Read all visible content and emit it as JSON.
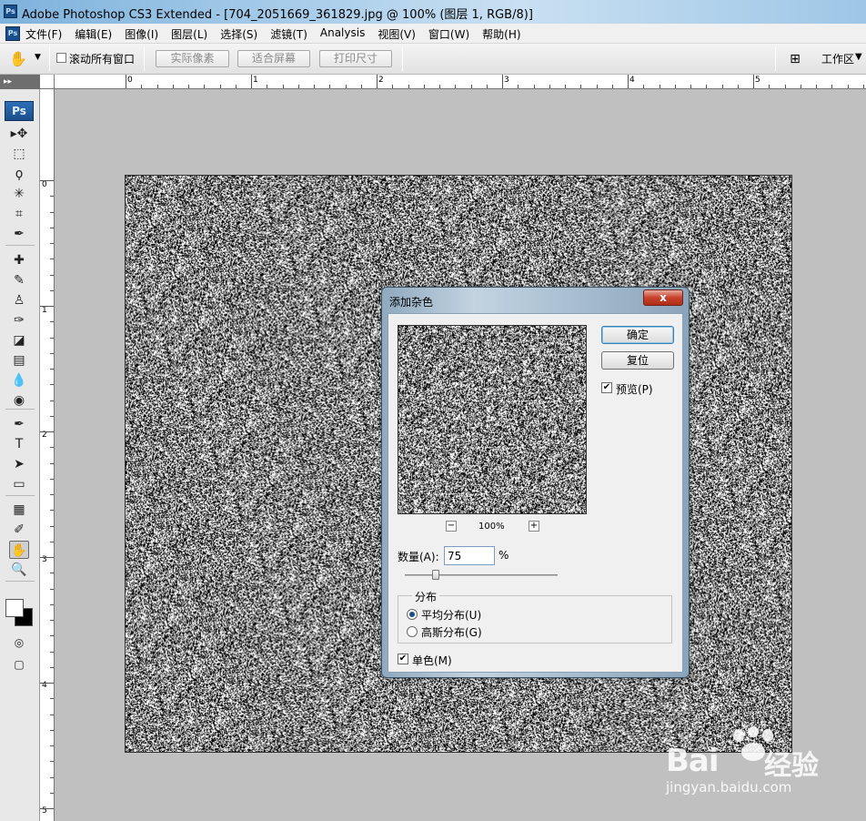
{
  "window": {
    "title": "Adobe Photoshop CS3 Extended - [704_2051669_361829.jpg @ 100% (图层 1, RGB/8)]",
    "app_badge": "Ps"
  },
  "menu": [
    {
      "label": "文件(F)"
    },
    {
      "label": "编辑(E)"
    },
    {
      "label": "图像(I)"
    },
    {
      "label": "图层(L)"
    },
    {
      "label": "选择(S)"
    },
    {
      "label": "滤镜(T)"
    },
    {
      "label": "Analysis"
    },
    {
      "label": "视图(V)"
    },
    {
      "label": "窗口(W)"
    },
    {
      "label": "帮助(H)"
    }
  ],
  "options_bar": {
    "scroll_all_label": "滚动所有窗口",
    "scroll_all_checked": false,
    "actual_pixels": "实际像素",
    "fit_screen": "适合屏幕",
    "print_size": "打印尺寸",
    "workspace": "工作区"
  },
  "toolbox": {
    "grip": "▸▸",
    "badge": "Ps",
    "tools": [
      {
        "name": "move-tool",
        "glyph": "▸✥"
      },
      {
        "name": "marquee-tool",
        "glyph": "⬚"
      },
      {
        "name": "lasso-tool",
        "glyph": "ϙ"
      },
      {
        "name": "magic-wand-tool",
        "glyph": "✳"
      },
      {
        "name": "crop-tool",
        "glyph": "⌗"
      },
      {
        "name": "slice-tool",
        "glyph": "✒"
      },
      {
        "name": "healing-brush-tool",
        "glyph": "✚"
      },
      {
        "name": "brush-tool",
        "glyph": "✎"
      },
      {
        "name": "clone-stamp-tool",
        "glyph": "♙"
      },
      {
        "name": "history-brush-tool",
        "glyph": "✑"
      },
      {
        "name": "eraser-tool",
        "glyph": "◪"
      },
      {
        "name": "gradient-tool",
        "glyph": "▤"
      },
      {
        "name": "blur-tool",
        "glyph": "💧"
      },
      {
        "name": "dodge-tool",
        "glyph": "◉"
      },
      {
        "name": "pen-tool",
        "glyph": "✒"
      },
      {
        "name": "type-tool",
        "glyph": "T"
      },
      {
        "name": "path-selection-tool",
        "glyph": "➤"
      },
      {
        "name": "rectangle-tool",
        "glyph": "▭"
      },
      {
        "name": "notes-tool",
        "glyph": "▦"
      },
      {
        "name": "eyedropper-tool",
        "glyph": "✐"
      },
      {
        "name": "hand-tool",
        "glyph": "✋"
      },
      {
        "name": "zoom-tool",
        "glyph": "🔍"
      }
    ]
  },
  "rulers": {
    "top": [
      "0",
      "1",
      "2",
      "3",
      "4",
      "5"
    ],
    "left": [
      "0",
      "1",
      "2",
      "3",
      "4",
      "5"
    ]
  },
  "dialog": {
    "title": "添加杂色",
    "close": "x",
    "ok": "确定",
    "reset": "复位",
    "preview_label": "预览(P)",
    "preview_checked": true,
    "zoom": "100%",
    "zoom_minus": "−",
    "zoom_plus": "+",
    "amount_label": "数量(A):",
    "amount_value": "75",
    "amount_unit": "%",
    "amount_slider_fraction": 0.2,
    "distribution_title": "分布",
    "uniform": "平均分布(U)",
    "gaussian": "高斯分布(G)",
    "distribution_selected": "uniform",
    "mono_label": "单色(M)",
    "mono_checked": true
  },
  "watermark": {
    "brand": "Bai",
    "brand2": "经验",
    "url": "jingyan.baidu.com"
  },
  "colors": {
    "workspace_bg": "#c0c0c0",
    "dialog_frame": "#aac0d2",
    "close_button": "#c7402b"
  }
}
